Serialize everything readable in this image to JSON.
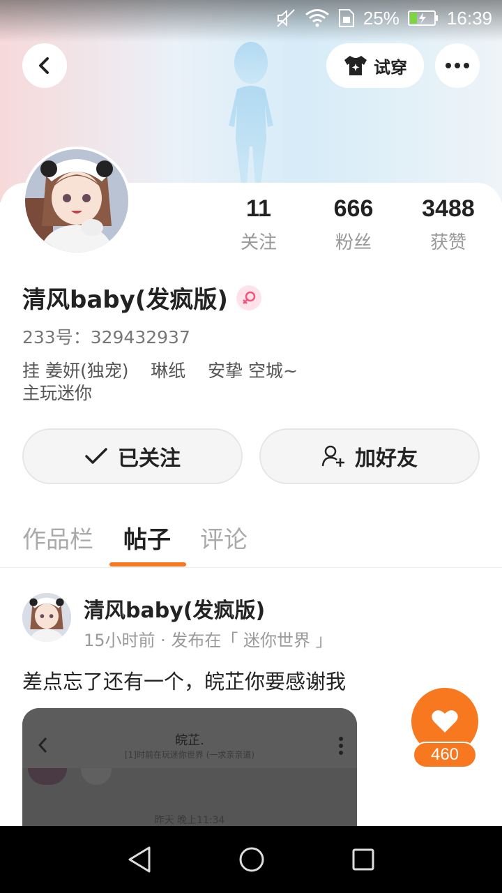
{
  "status_bar": {
    "battery": "25%",
    "time": "16:39",
    "icons": [
      "mute-icon",
      "wifi-icon",
      "sim-icon",
      "battery-charging-icon"
    ]
  },
  "header": {
    "try_on_label": "试穿",
    "icons": [
      "back-arrow-icon",
      "tshirt-sparkle-icon",
      "more-dots-icon"
    ]
  },
  "profile": {
    "stats": [
      {
        "value": "11",
        "label": "关注"
      },
      {
        "value": "666",
        "label": "粉丝"
      },
      {
        "value": "3488",
        "label": "获赞"
      }
    ],
    "name": "清风baby(发疯版)",
    "gender_icon": "female-symbol-icon",
    "uid": "233号：329432937",
    "bio_line1": "挂 姜妍(独宠)    琳纸    安挚 空城~",
    "bio_line2": "主玩迷你"
  },
  "actions": {
    "follow_label": "已关注",
    "add_friend_label": "加好友",
    "icons": [
      "checkmark-icon",
      "add-user-icon"
    ]
  },
  "tabs": [
    {
      "label": "作品栏",
      "active": false
    },
    {
      "label": "帖子",
      "active": true
    },
    {
      "label": "评论",
      "active": false
    }
  ],
  "post": {
    "author": "清风baby(发疯版)",
    "meta": "15小时前 · 发布在「 迷你世界 」",
    "text": "差点忘了还有一个，皖芷你要感谢我",
    "image": {
      "title": "皖芷.",
      "subtitle": "[1]时前在玩迷你世界 (一求亲亲道)",
      "time": "昨天 晚上11:34"
    }
  },
  "like": {
    "count": "460"
  },
  "colors": {
    "accent": "#f7781e",
    "text_primary": "#222222",
    "text_secondary": "#999999"
  }
}
